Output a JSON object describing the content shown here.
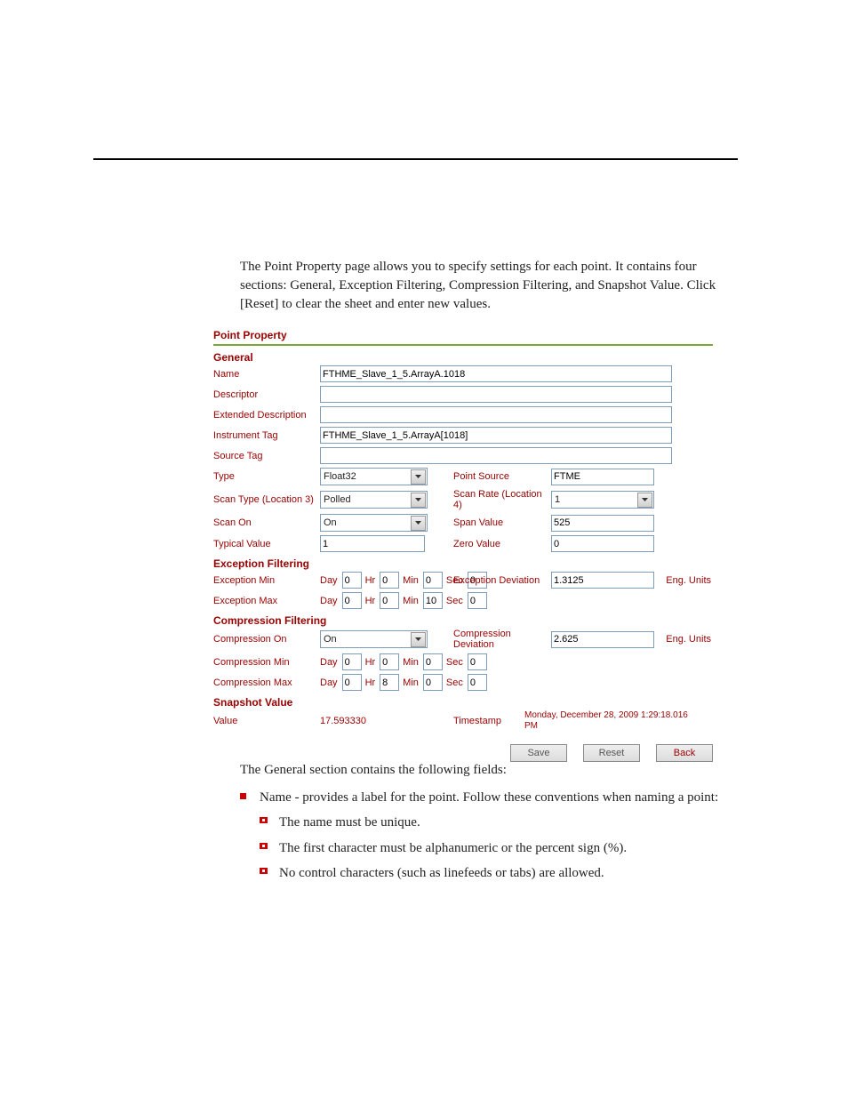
{
  "intro": "The Point Property page allows you to specify settings for each point. It contains four sections: General, Exception Filtering, Compression Filtering, and Snapshot Value. Click [Reset] to clear the sheet and enter new values.",
  "title": "Point Property",
  "section_general": "General",
  "general": {
    "name_label": "Name",
    "name_value": "FTHME_Slave_1_5.ArrayA.1018",
    "descriptor_label": "Descriptor",
    "descriptor_value": "",
    "ext_desc_label": "Extended Description",
    "ext_desc_value": "",
    "inst_tag_label": "Instrument Tag",
    "inst_tag_value": "FTHME_Slave_1_5.ArrayA[1018]",
    "source_tag_label": "Source Tag",
    "source_tag_value": "",
    "type_label": "Type",
    "type_value": "Float32",
    "point_source_label": "Point Source",
    "point_source_value": "FTME",
    "scan_type_label": "Scan Type (Location 3)",
    "scan_type_value": "Polled",
    "scan_rate_label": "Scan Rate (Location 4)",
    "scan_rate_value": "1",
    "scan_on_label": "Scan On",
    "scan_on_value": "On",
    "span_value_label": "Span Value",
    "span_value": "525",
    "typical_value_label": "Typical Value",
    "typical_value": "1",
    "zero_value_label": "Zero Value",
    "zero_value": "0"
  },
  "section_exception": "Exception Filtering",
  "exception": {
    "min_label": "Exception Min",
    "min": {
      "day": "0",
      "hr": "0",
      "min": "0",
      "sec": "0"
    },
    "max_label": "Exception Max",
    "max": {
      "day": "0",
      "hr": "0",
      "min": "10",
      "sec": "0"
    },
    "dev_label": "Exception Deviation",
    "dev_value": "1.3125",
    "eng_units": "Eng. Units"
  },
  "section_compression": "Compression Filtering",
  "compression": {
    "on_label": "Compression On",
    "on_value": "On",
    "min_label": "Compression Min",
    "min": {
      "day": "0",
      "hr": "0",
      "min": "0",
      "sec": "0"
    },
    "max_label": "Compression Max",
    "max": {
      "day": "0",
      "hr": "8",
      "min": "0",
      "sec": "0"
    },
    "dev_label": "Compression Deviation",
    "dev_value": "2.625",
    "eng_units": "Eng. Units"
  },
  "section_snapshot": "Snapshot Value",
  "snapshot": {
    "value_label": "Value",
    "value": "17.593330",
    "timestamp_label": "Timestamp",
    "timestamp": "Monday, December 28, 2009 1:29:18.016 PM"
  },
  "time_labels": {
    "day": "Day",
    "hr": "Hr",
    "min": "Min",
    "sec": "Sec"
  },
  "buttons": {
    "save": "Save",
    "reset": "Reset",
    "back": "Back"
  },
  "after_intro": "The General section contains the following fields:",
  "after_name": "Name - provides a label for the point. Follow these conventions when naming a point:",
  "sub1": "The name must be unique.",
  "sub2": "The first character must be alphanumeric or the percent sign (%).",
  "sub3": "No control characters (such as linefeeds or tabs) are allowed."
}
